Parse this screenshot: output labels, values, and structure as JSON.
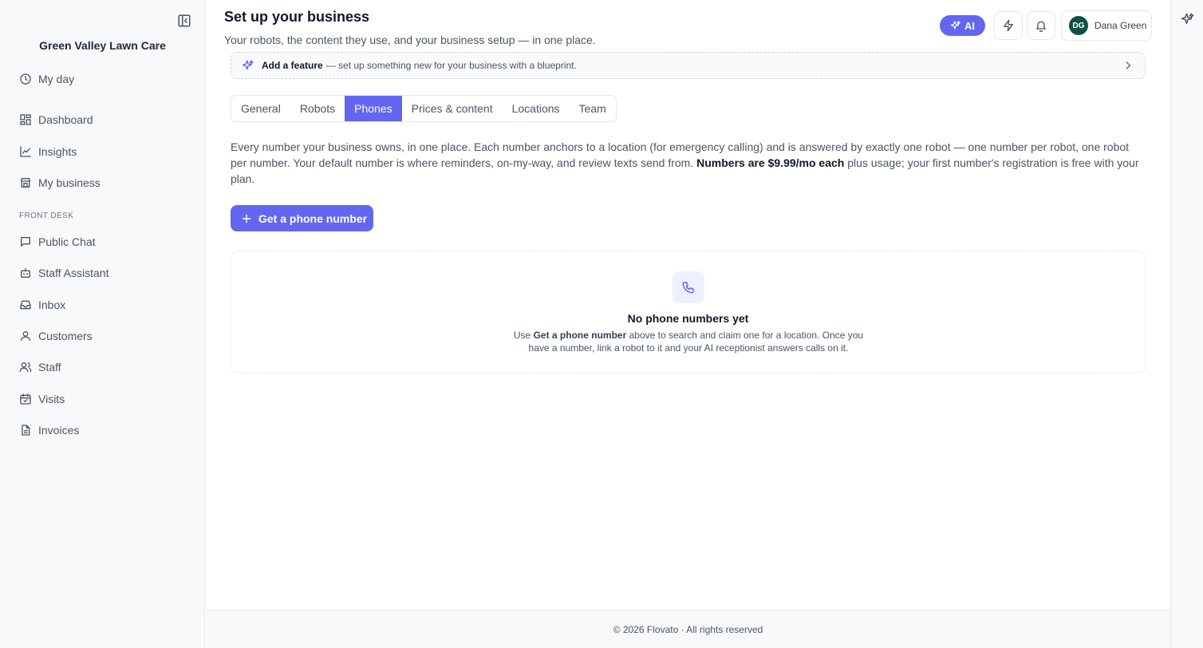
{
  "sidebar": {
    "business_name": "Green Valley Lawn Care",
    "collapse_icon": "sidebar-collapse-icon",
    "items": [
      {
        "label": "My day",
        "icon": "clock-icon"
      },
      {
        "label": "Dashboard",
        "icon": "dashboard-icon"
      },
      {
        "label": "Insights",
        "icon": "chart-line-icon"
      },
      {
        "label": "My business",
        "icon": "store-icon"
      },
      {
        "label": "Public Chat",
        "icon": "chat-icon"
      },
      {
        "label": "Staff Assistant",
        "icon": "bot-icon"
      },
      {
        "label": "Inbox",
        "icon": "inbox-icon"
      },
      {
        "label": "Customers",
        "icon": "user-icon"
      },
      {
        "label": "Staff",
        "icon": "users-icon"
      },
      {
        "label": "Visits",
        "icon": "calendar-check-icon"
      },
      {
        "label": "Invoices",
        "icon": "document-icon"
      }
    ],
    "section_label": "FRONT DESK"
  },
  "header": {
    "title": "Set up your business",
    "subtitle": "Your robots, the content they use, and your business setup — in one place.",
    "ai_label": "AI",
    "user": {
      "initials": "DG",
      "name": "Dana Green"
    }
  },
  "banner": {
    "bold": "Add a feature",
    "rest": "— set up something new for your business with a blueprint."
  },
  "tabs": [
    {
      "label": "General",
      "active": false
    },
    {
      "label": "Robots",
      "active": false
    },
    {
      "label": "Phones",
      "active": true
    },
    {
      "label": "Prices & content",
      "active": false
    },
    {
      "label": "Locations",
      "active": false
    },
    {
      "label": "Team",
      "active": false
    }
  ],
  "description": {
    "part1": "Every number your business owns, in one place. Each number anchors to a location (for emergency calling) and is answered by exactly one robot — one number per robot, one robot per number. Your default number is where reminders, on-my-way, and review texts send from.",
    "bold": "Numbers are $9.99/mo each",
    "part2": "plus usage; your first number's registration is free with your plan."
  },
  "cta_label": "Get a phone number",
  "empty_state": {
    "title": "No phone numbers yet",
    "text_pre": "Use",
    "text_bold": "Get a phone number",
    "text_post": "above to search and claim one for a location. Once you have a number, link a robot to it and your AI receptionist answers calls on it."
  },
  "footer": "© 2026 Flovato · All rights reserved",
  "colors": {
    "accent": "#6366f1",
    "avatar_bg": "#0f4f4a",
    "sidebar_bg": "#f8f9fa"
  }
}
